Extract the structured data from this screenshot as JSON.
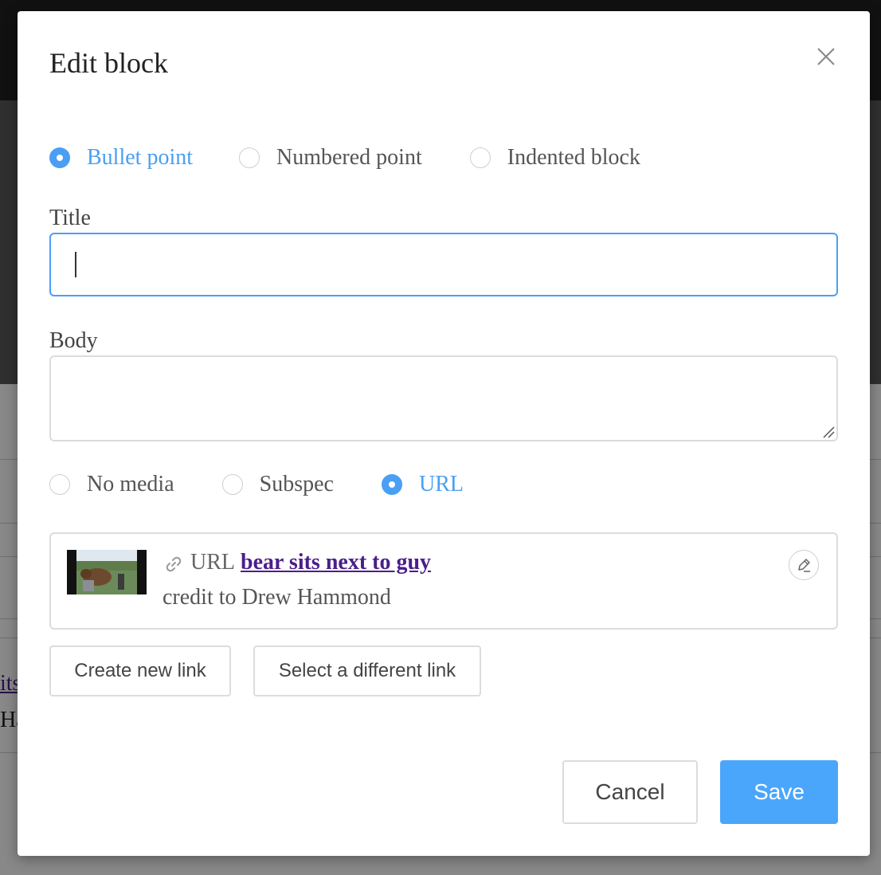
{
  "background": {
    "link_fragment": "its",
    "text_fragment": "Ha"
  },
  "modal": {
    "title": "Edit block",
    "close_icon": "close-icon",
    "block_type": {
      "options": [
        "Bullet point",
        "Numbered point",
        "Indented block"
      ],
      "selected": "Bullet point"
    },
    "title_field": {
      "label": "Title",
      "value": ""
    },
    "body_field": {
      "label": "Body",
      "value": ""
    },
    "media_type": {
      "options": [
        "No media",
        "Subspec",
        "URL"
      ],
      "selected": "URL"
    },
    "media_card": {
      "icon": "link-icon",
      "prefix": "URL",
      "link_text": "bear sits next to guy",
      "credit": "credit to Drew Hammond",
      "edit_icon": "pencil-icon"
    },
    "buttons": {
      "create_link": "Create new link",
      "select_link": "Select a different link",
      "cancel": "Cancel",
      "save": "Save"
    }
  },
  "colors": {
    "accent": "#4a9ff5",
    "save_button": "#4aa6fb",
    "link": "#4b1e8a"
  }
}
